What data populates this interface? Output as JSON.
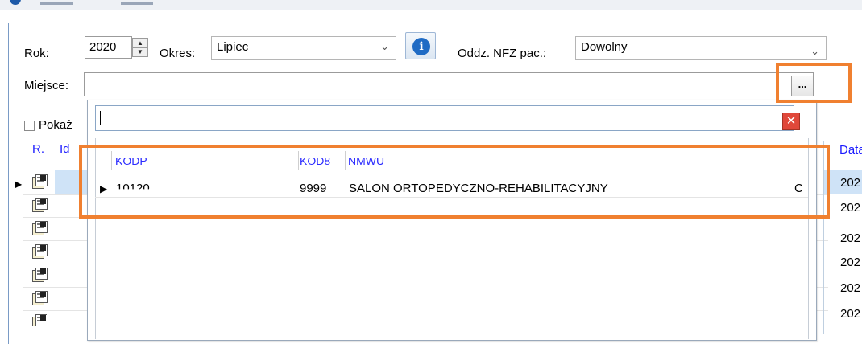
{
  "form": {
    "rok_label": "Rok:",
    "rok_value": "2020",
    "okres_label": "Okres:",
    "okres_value": "Lipiec",
    "nfz_label": "Oddz. NFZ pac.:",
    "nfz_value": "Dowolny",
    "miejsce_label": "Miejsce:",
    "miejsce_value": "",
    "ellipsis_label": "...",
    "info_glyph": "i",
    "checkbox_label": "Pokaż"
  },
  "grid": {
    "col_r": "R.",
    "col_id": "Id",
    "col_data": "Data",
    "date_cells": [
      "202",
      "202",
      "202",
      "202",
      "202",
      "202"
    ]
  },
  "popup": {
    "search_value": "",
    "clear_glyph": "✕",
    "columns": [
      "KODP",
      "KOD8",
      "NMWU"
    ],
    "rows": [
      {
        "kodp": "10120",
        "kod8": "9999",
        "nmwu": "SALON ORTOPEDYCZNO-REHABILITACYJNY",
        "extra": "C"
      }
    ]
  },
  "colors": {
    "highlight": "#f08030",
    "header_text": "#2b2bff",
    "selection": "#cfe3f7"
  }
}
